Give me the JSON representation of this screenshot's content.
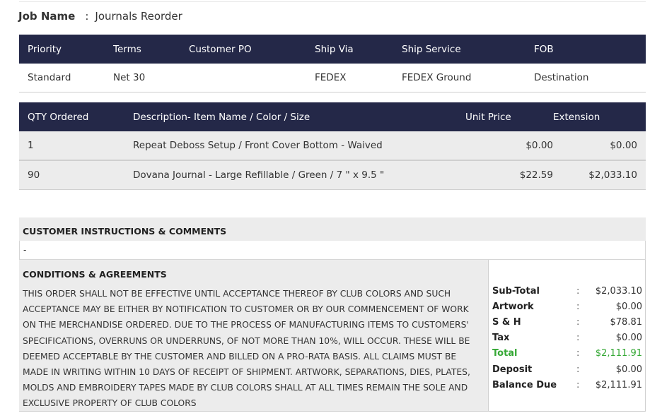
{
  "job": {
    "label": "Job Name",
    "colon": ":",
    "value": "Journals Reorder"
  },
  "shipping": {
    "headers": [
      "Priority",
      "Terms",
      "Customer PO",
      "Ship Via",
      "Ship Service",
      "FOB"
    ],
    "row": [
      "Standard",
      "Net 30",
      "",
      "FEDEX",
      "FEDEX Ground",
      "Destination"
    ]
  },
  "items": {
    "headers": [
      "QTY Ordered",
      "Description- Item Name / Color / Size",
      "Unit Price",
      "Extension"
    ],
    "rows": [
      [
        "1",
        "Repeat Deboss Setup / Front Cover Bottom - Waived",
        "$0.00",
        "$0.00"
      ],
      [
        "90",
        "Dovana Journal - Large Refillable / Green / 7 \" x 9.5 \"",
        "$22.59",
        "$2,033.10"
      ]
    ]
  },
  "instructions": {
    "title": "CUSTOMER INSTRUCTIONS & COMMENTS",
    "text": "-"
  },
  "conditions": {
    "title": "CONDITIONS & AGREEMENTS",
    "text": "THIS ORDER SHALL NOT BE EFFECTIVE UNTIL ACCEPTANCE THEREOF BY CLUB COLORS AND SUCH ACCEPTANCE MAY BE EITHER BY NOTIFICATION TO CUSTOMER OR BY OUR COMMENCEMENT OF WORK ON THE MERCHANDISE ORDERED. DUE TO THE PROCESS OF MANUFACTURING ITEMS TO CUSTOMERS' SPECIFICATIONS, OVERRUNS OR UNDERRUNS, OF NOT MORE THAN 10%, WILL OCCUR. THESE WILL BE DEEMED ACCEPTABLE BY THE CUSTOMER AND BILLED ON A PRO-RATA BASIS. ALL CLAIMS MUST BE MADE IN WRITING WITHIN 10 DAYS OF RECEIPT OF SHIPMENT. ARTWORK, SEPARATIONS, DIES, PLATES, MOLDS AND EMBROIDERY TAPES MADE BY CLUB COLORS SHALL AT ALL TIMES REMAIN THE SOLE AND EXCLUSIVE PROPERTY OF CLUB COLORS"
  },
  "totals": [
    {
      "label": "Sub-Total",
      "colon": ":",
      "value": "$2,033.10"
    },
    {
      "label": "Artwork",
      "colon": ":",
      "value": "$0.00"
    },
    {
      "label": "S & H",
      "colon": ":",
      "value": "$78.81"
    },
    {
      "label": "Tax",
      "colon": ":",
      "value": "$0.00"
    },
    {
      "label": "Total",
      "colon": ":",
      "value": "$2,111.91"
    },
    {
      "label": "Deposit",
      "colon": ":",
      "value": "$0.00"
    },
    {
      "label": "Balance Due",
      "colon": ":",
      "value": "$2,111.91"
    }
  ],
  "colors": {
    "header_bg": "#242848",
    "row_bg": "#ececec",
    "total_green": "#35a835"
  }
}
